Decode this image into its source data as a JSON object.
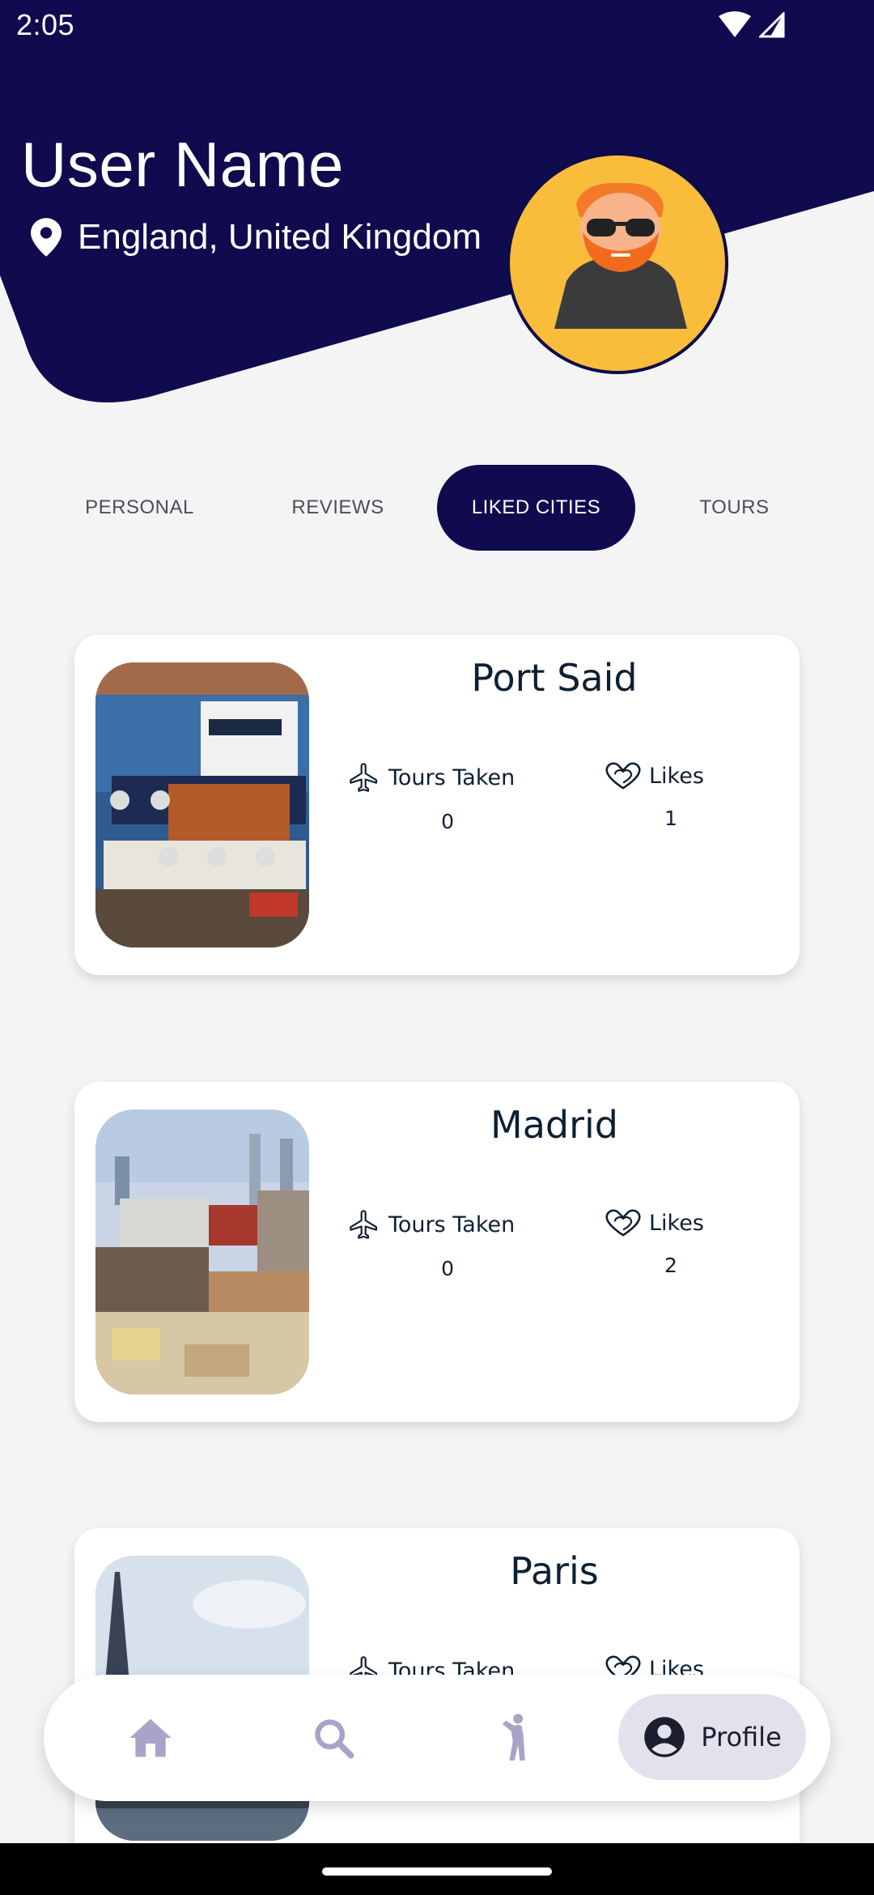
{
  "status_bar": {
    "time": "2:05"
  },
  "profile": {
    "name": "User Name",
    "location": "England, United Kingdom"
  },
  "tabs": [
    {
      "label": "PERSONAL",
      "active": false
    },
    {
      "label": "REVIEWS",
      "active": false
    },
    {
      "label": "LIKED CITIES",
      "active": true
    },
    {
      "label": "TOURS",
      "active": false
    }
  ],
  "cities": [
    {
      "name": "Port Said",
      "tours_label": "Tours Taken",
      "tours_value": "0",
      "likes_label": "Likes",
      "likes_value": "1"
    },
    {
      "name": "Madrid",
      "tours_label": "Tours Taken",
      "tours_value": "0",
      "likes_label": "Likes",
      "likes_value": "2"
    },
    {
      "name": "Paris",
      "tours_label": "Tours Taken",
      "tours_value": "",
      "likes_label": "Likes",
      "likes_value": ""
    }
  ],
  "bottom_nav": {
    "items": [
      {
        "icon": "home-icon"
      },
      {
        "icon": "search-icon"
      },
      {
        "icon": "person-walking-icon"
      },
      {
        "icon": "account-circle-icon",
        "label": "Profile",
        "active": true
      }
    ]
  },
  "colors": {
    "header": "#100b4f",
    "avatar_bg": "#f9bd3b",
    "active_tab": "#100b4f",
    "nav_active_bg": "#e2e1ec",
    "nav_inactive_icon": "#a8a4c8"
  }
}
